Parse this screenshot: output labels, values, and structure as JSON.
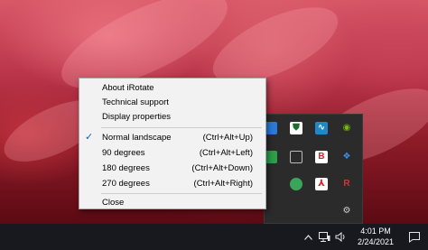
{
  "context_menu": {
    "items_top": [
      {
        "label": "About iRotate"
      },
      {
        "label": "Technical support"
      },
      {
        "label": "Display properties"
      }
    ],
    "rotation_items": [
      {
        "label": "Normal landscape",
        "shortcut": "(Ctrl+Alt+Up)",
        "checked": true
      },
      {
        "label": "90 degrees",
        "shortcut": "(Ctrl+Alt+Left)",
        "checked": false
      },
      {
        "label": "180 degrees",
        "shortcut": "(Ctrl+Alt+Down)",
        "checked": false
      },
      {
        "label": "270 degrees",
        "shortcut": "(Ctrl+Alt+Right)",
        "checked": false
      }
    ],
    "close_label": "Close",
    "checkmark": "✓"
  },
  "tray_overflow": {
    "icons": [
      "blue-app-icon",
      "shield-icon",
      "waveform-icon",
      "nvidia-icon",
      "green-app-icon",
      "window-icon",
      "red-b-icon",
      "dropbox-icon",
      "green-globe-icon",
      "acrobat-icon",
      "red-r-icon",
      "gear-icon"
    ]
  },
  "taskbar": {
    "time": "4:01 PM",
    "date": "2/24/2021",
    "icons": [
      "chevron-up-icon",
      "network-icon",
      "volume-icon",
      "notification-icon"
    ]
  },
  "colors": {
    "menu_bg": "#f2f2f2",
    "taskbar_bg": "#17191f",
    "check_color": "#0b5fbf"
  }
}
